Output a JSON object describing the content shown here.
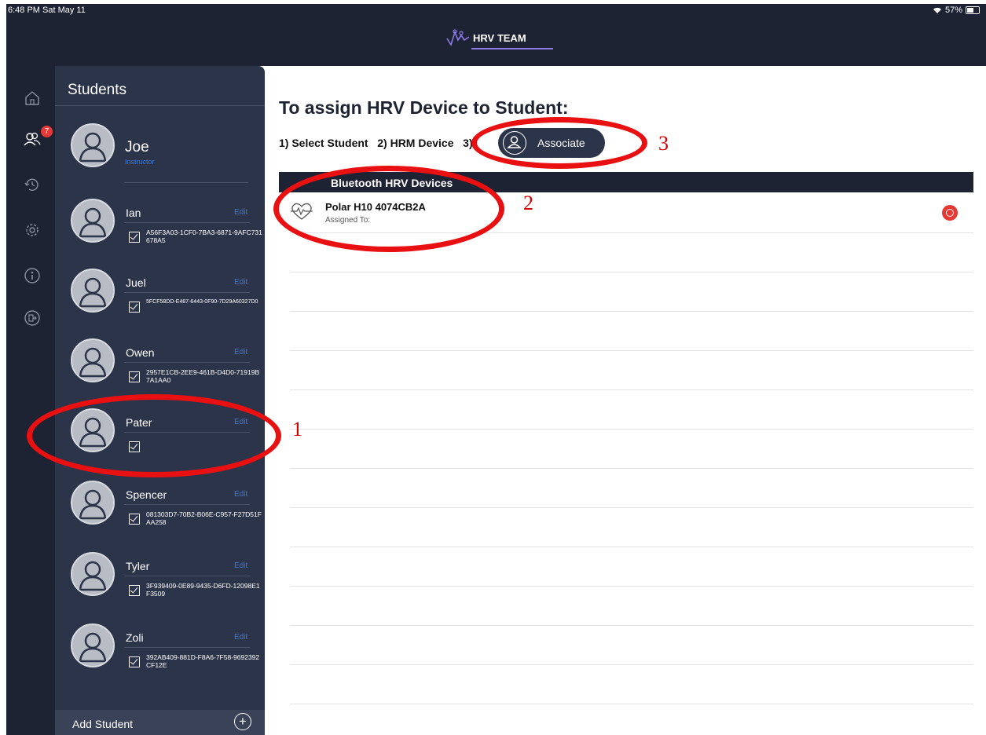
{
  "status_bar": {
    "time": "6:48 PM",
    "date": "Sat May 11",
    "battery": "57%"
  },
  "app": {
    "logo_text": "HRV TEAM"
  },
  "nav": {
    "badge_count": "7",
    "icons": [
      "home-icon",
      "students-icon",
      "history-icon",
      "settings-icon",
      "info-icon",
      "logout-icon"
    ]
  },
  "students_panel": {
    "title": "Students",
    "instructor": {
      "name": "Joe",
      "role": "Instructor"
    },
    "edit_label": "Edit",
    "students": [
      {
        "name": "Ian",
        "device_id": "A56F3A03-1CF0-7BA3-6871-9AFC731678A5"
      },
      {
        "name": "Juel",
        "device_id": "5FCF58DD-E487-6443-0F90-7D29A60327D0"
      },
      {
        "name": "Owen",
        "device_id": "2957E1CB-2EE9-461B-D4D0-71919B7A1AA0"
      },
      {
        "name": "Pater",
        "device_id": ""
      },
      {
        "name": "Spencer",
        "device_id": "081303D7-70B2-B06E-C957-F27D51FAA258"
      },
      {
        "name": "Tyler",
        "device_id": "3F939409-0E89-9435-D6FD-12098E1F3509"
      },
      {
        "name": "Zoli",
        "device_id": "392AB409-881D-F8A6-7F58-9692392CF12E"
      }
    ],
    "add_label": "Add Student"
  },
  "main": {
    "title": "To assign HRV Device to Student:",
    "steps": "1) Select Student   2) HRM Device   3)",
    "associate_label": "Associate",
    "devices_header": "Bluetooth HRV Devices",
    "devices": [
      {
        "name": "Polar H10 4074CB2A",
        "assigned": "Assigned To:"
      }
    ]
  },
  "annotations": {
    "one": "1",
    "two": "2",
    "three": "3"
  },
  "colors": {
    "dark": "#1d2333",
    "panel": "#2c3449",
    "accent": "#3d7bd8",
    "annotation": "#e81010"
  }
}
